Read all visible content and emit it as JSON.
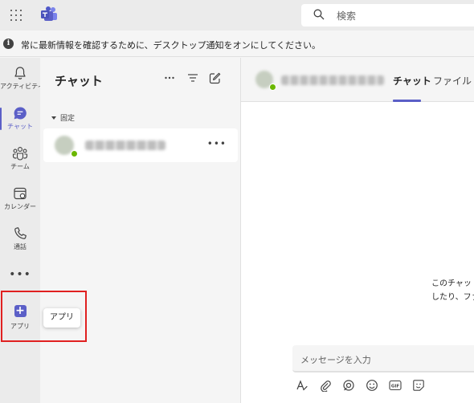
{
  "search": {
    "placeholder": "検索"
  },
  "notice": {
    "text": "常に最新情報を確認するために、デスクトップ通知をオンにしてください。"
  },
  "rail": {
    "items": [
      {
        "label": "アクティビティ",
        "icon": "bell-icon"
      },
      {
        "label": "チャット",
        "icon": "chat-icon"
      },
      {
        "label": "チーム",
        "icon": "teams-icon"
      },
      {
        "label": "カレンダー",
        "icon": "calendar-icon"
      },
      {
        "label": "通話",
        "icon": "phone-icon"
      }
    ],
    "more": "•••",
    "apps_label": "アプリ"
  },
  "tooltip": {
    "text": "アプリ"
  },
  "chat_list": {
    "title": "チャット",
    "pinned_label": "固定",
    "row_more": "•••"
  },
  "conversation": {
    "tabs": [
      {
        "label": "チャット"
      },
      {
        "label": "ファイル"
      }
    ],
    "empty_line1": "このチャット",
    "empty_line2": "したり、ファ",
    "compose_placeholder": "メッセージを入力"
  },
  "colors": {
    "accent": "#5b5fc7",
    "highlight": "#e02020",
    "presence": "#6bb700"
  }
}
